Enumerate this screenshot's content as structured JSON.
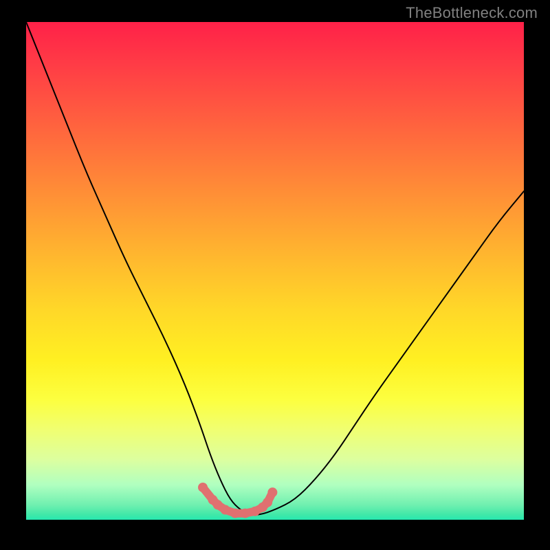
{
  "watermark": "TheBottleneck.com",
  "chart_data": {
    "type": "line",
    "title": "",
    "xlabel": "",
    "ylabel": "",
    "xlim": [
      0,
      100
    ],
    "ylim": [
      0,
      100
    ],
    "legend": false,
    "grid": false,
    "series": [
      {
        "name": "bottleneck-curve",
        "x": [
          0,
          4,
          8,
          12,
          16,
          20,
          24,
          28,
          32,
          35,
          37,
          39,
          41,
          43,
          45,
          47,
          50,
          54,
          58,
          62,
          66,
          70,
          75,
          80,
          85,
          90,
          95,
          100
        ],
        "y": [
          100,
          90,
          80,
          70,
          61,
          52,
          44,
          36,
          27,
          19,
          13,
          8,
          4,
          2,
          1,
          1,
          2,
          4,
          8,
          13,
          19,
          25,
          32,
          39,
          46,
          53,
          60,
          66
        ],
        "color": "#000000",
        "width": 2
      },
      {
        "name": "optimal-zone-markers",
        "x": [
          35.5,
          37.5,
          38.5,
          40,
          42,
          44,
          46,
          47.5,
          48.5,
          49.5
        ],
        "y": [
          6.5,
          4.0,
          3.0,
          2.0,
          1.3,
          1.3,
          1.7,
          2.5,
          3.5,
          5.5
        ],
        "color": "#e07070",
        "width": 12,
        "style": "markers"
      }
    ],
    "background": {
      "type": "vertical-gradient",
      "stops": [
        {
          "pos": 0.0,
          "color": "#ff2148"
        },
        {
          "pos": 0.28,
          "color": "#ff7a3a"
        },
        {
          "pos": 0.68,
          "color": "#fff022"
        },
        {
          "pos": 0.88,
          "color": "#dcffa0"
        },
        {
          "pos": 1.0,
          "color": "#26e8b0"
        }
      ]
    }
  }
}
